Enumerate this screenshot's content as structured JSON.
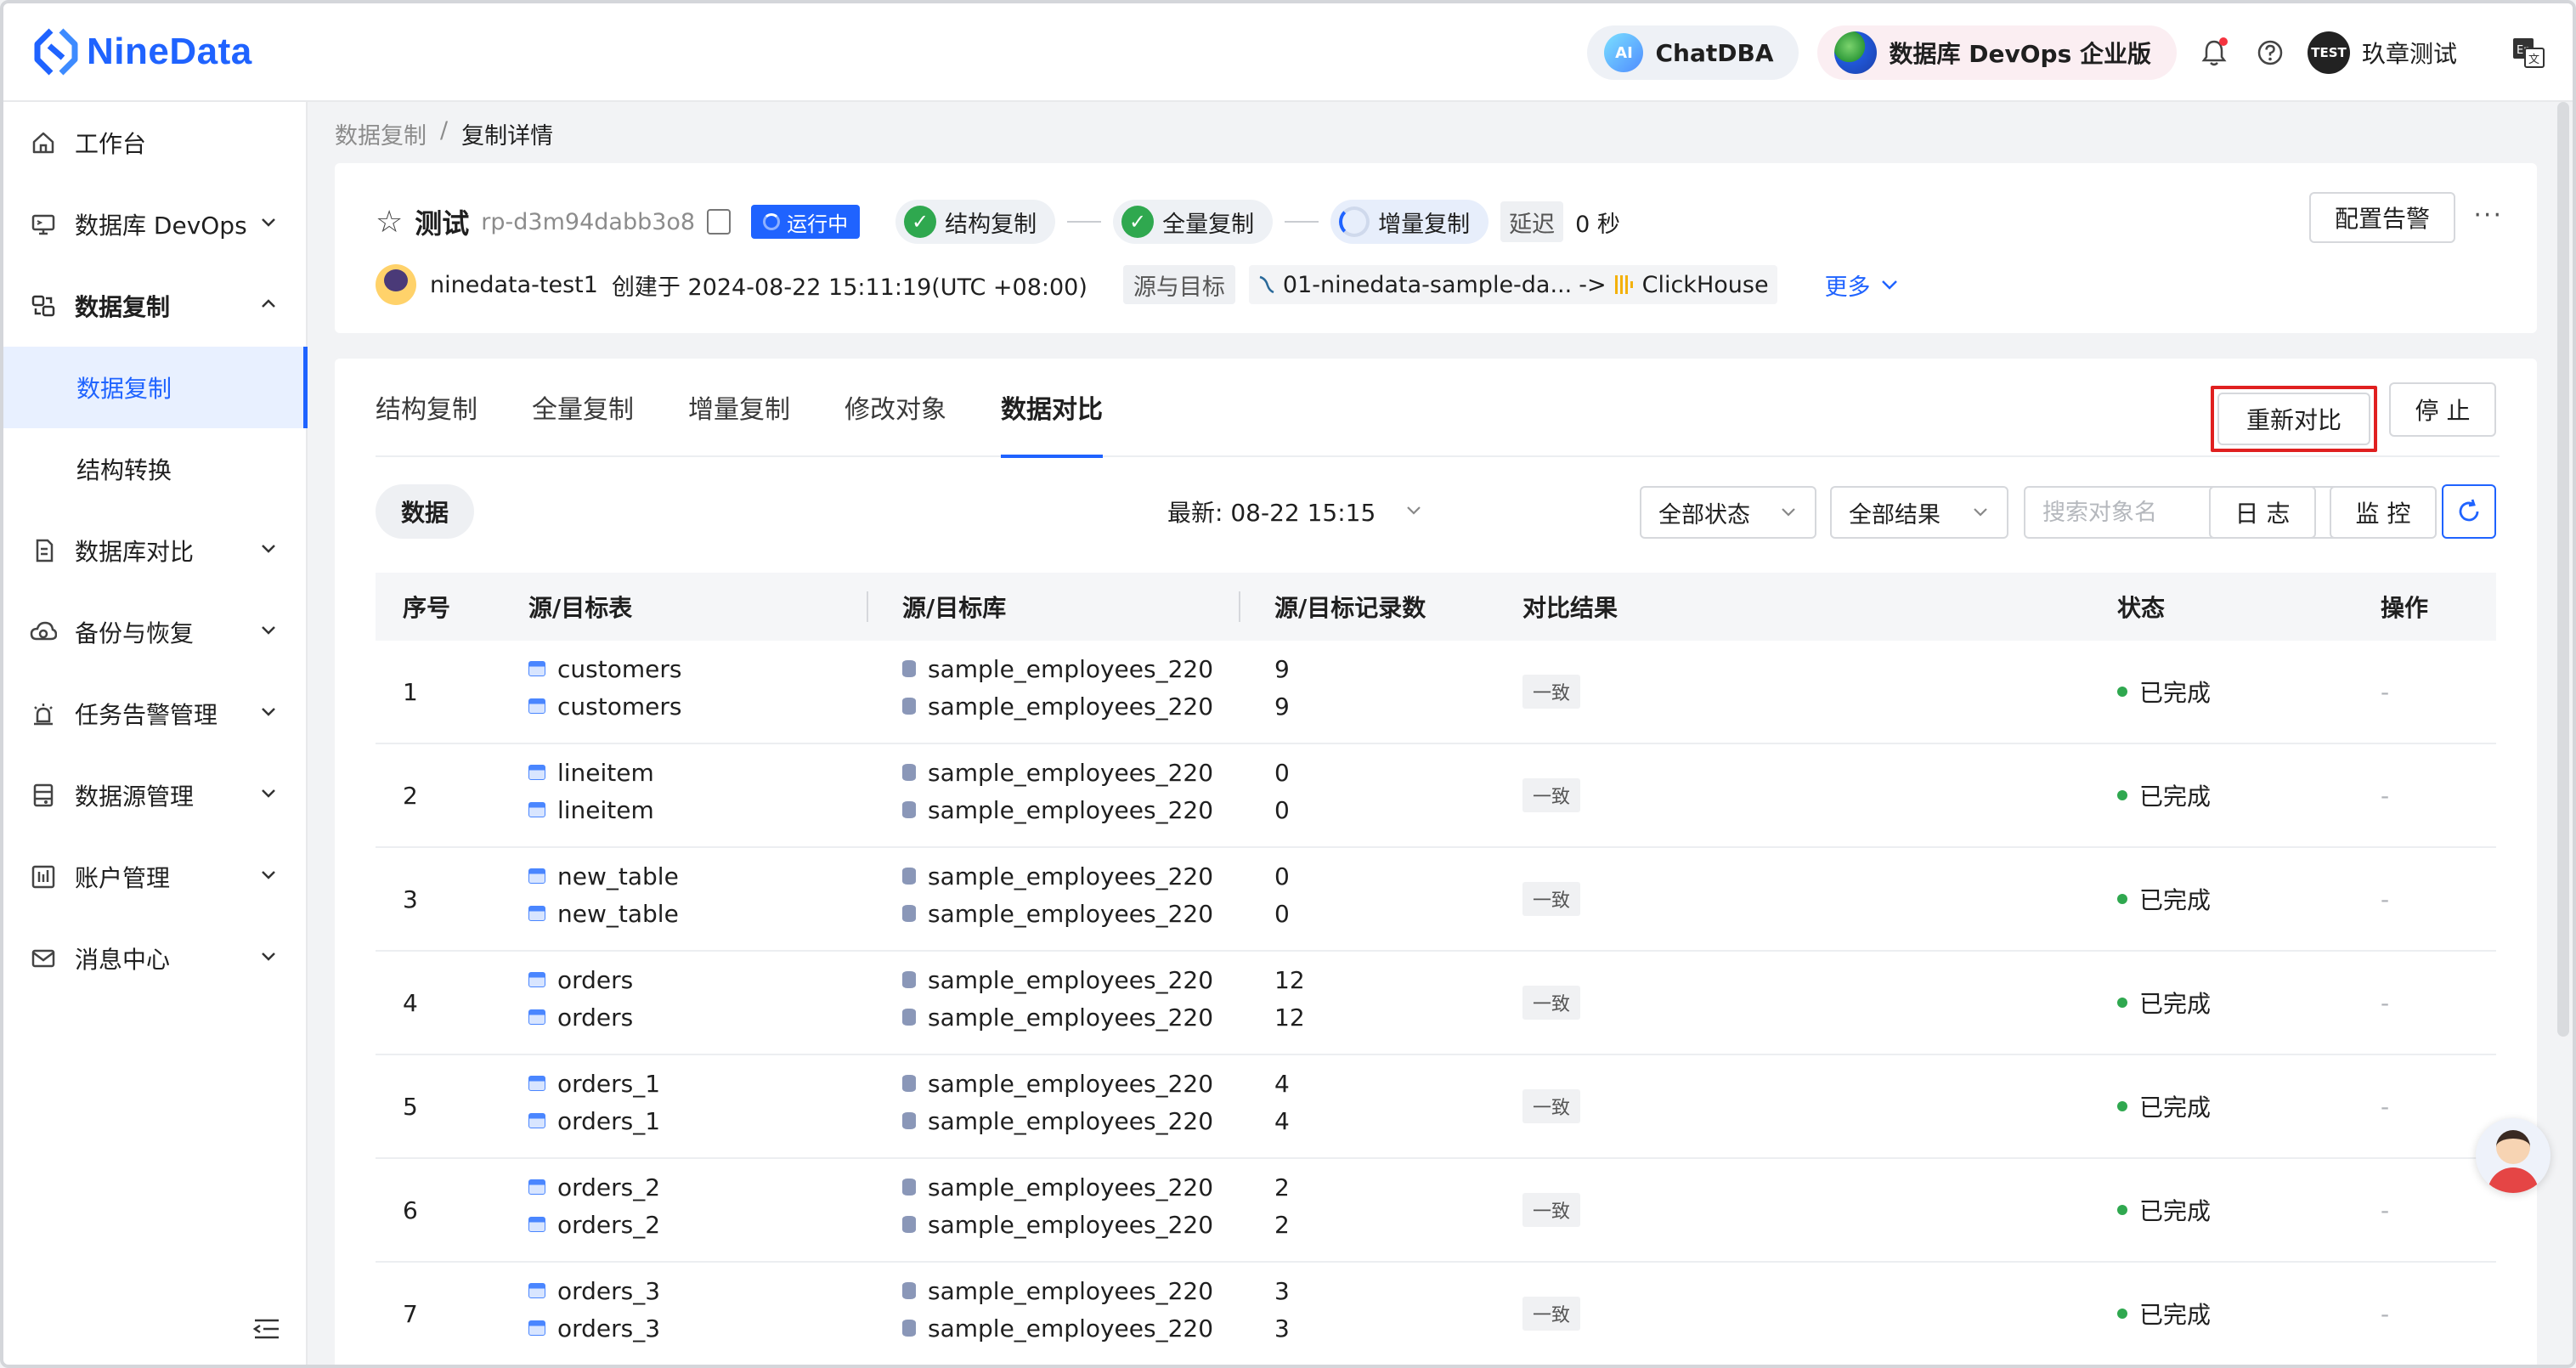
{
  "header": {
    "logo": "NineData",
    "chatdba": "ChatDBA",
    "ai_badge": "AI",
    "devops": "数据库 DevOps 企业版",
    "user_badge": "TEST",
    "user_name": "玖章测试",
    "icons": [
      "bell-icon",
      "help-icon",
      "language-icon"
    ]
  },
  "sidebar": {
    "items": [
      {
        "label": "工作台",
        "icon": "home-icon"
      },
      {
        "label": "数据库 DevOps",
        "icon": "monitor-icon"
      },
      {
        "label": "数据复制",
        "icon": "replication-icon"
      },
      {
        "label": "数据库对比",
        "icon": "compare-icon"
      },
      {
        "label": "备份与恢复",
        "icon": "cloud-backup-icon"
      },
      {
        "label": "任务告警管理",
        "icon": "alarm-icon"
      },
      {
        "label": "数据源管理",
        "icon": "datasource-icon"
      },
      {
        "label": "账户管理",
        "icon": "account-icon"
      },
      {
        "label": "消息中心",
        "icon": "mail-icon"
      }
    ],
    "sub_items": [
      "数据复制",
      "结构转换"
    ]
  },
  "breadcrumb": {
    "parent": "数据复制",
    "sep": "/",
    "current": "复制详情"
  },
  "task": {
    "name": "测试",
    "id": "rp-d3m94dabb3o8",
    "state": "运行中",
    "stages": [
      "结构复制",
      "全量复制",
      "增量复制"
    ],
    "delay_label": "延迟",
    "delay_value": "0 秒",
    "creator": "ninedata-test1",
    "created_text": "创建于 2024-08-22 15:11:19(UTC +08:00)",
    "src_target_label": "源与目标",
    "source": "01-ninedata-sample-da...",
    "arrow": "->",
    "target": "ClickHouse",
    "more": "更多",
    "config_alert": "配置告警",
    "more_dots": "···"
  },
  "tabs": [
    "结构复制",
    "全量复制",
    "增量复制",
    "修改对象",
    "数据对比"
  ],
  "actions": {
    "recompare": "重新对比",
    "stop": "停 止"
  },
  "toolbar": {
    "data_chip": "数据",
    "latest": "最新:  08-22 15:15",
    "status_filter": "全部状态",
    "result_filter": "全部结果",
    "search_placeholder": "搜索对象名",
    "log": "日 志",
    "monitor": "监 控"
  },
  "table": {
    "headers": [
      "序号",
      "源/目标表",
      "源/目标库",
      "源/目标记录数",
      "对比结果",
      "状态",
      "操作"
    ],
    "rows": [
      {
        "no": "1",
        "src_table": "customers",
        "dst_table": "customers",
        "src_db": "sample_employees_220",
        "dst_db": "sample_employees_220",
        "src_count": "9",
        "dst_count": "9",
        "result": "一致",
        "status": "已完成",
        "op": "-"
      },
      {
        "no": "2",
        "src_table": "lineitem",
        "dst_table": "lineitem",
        "src_db": "sample_employees_220",
        "dst_db": "sample_employees_220",
        "src_count": "0",
        "dst_count": "0",
        "result": "一致",
        "status": "已完成",
        "op": "-"
      },
      {
        "no": "3",
        "src_table": "new_table",
        "dst_table": "new_table",
        "src_db": "sample_employees_220",
        "dst_db": "sample_employees_220",
        "src_count": "0",
        "dst_count": "0",
        "result": "一致",
        "status": "已完成",
        "op": "-"
      },
      {
        "no": "4",
        "src_table": "orders",
        "dst_table": "orders",
        "src_db": "sample_employees_220",
        "dst_db": "sample_employees_220",
        "src_count": "12",
        "dst_count": "12",
        "result": "一致",
        "status": "已完成",
        "op": "-"
      },
      {
        "no": "5",
        "src_table": "orders_1",
        "dst_table": "orders_1",
        "src_db": "sample_employees_220",
        "dst_db": "sample_employees_220",
        "src_count": "4",
        "dst_count": "4",
        "result": "一致",
        "status": "已完成",
        "op": "-"
      },
      {
        "no": "6",
        "src_table": "orders_2",
        "dst_table": "orders_2",
        "src_db": "sample_employees_220",
        "dst_db": "sample_employees_220",
        "src_count": "2",
        "dst_count": "2",
        "result": "一致",
        "status": "已完成",
        "op": "-"
      },
      {
        "no": "7",
        "src_table": "orders_3",
        "dst_table": "orders_3",
        "src_db": "sample_employees_220",
        "dst_db": "sample_employees_220",
        "src_count": "3",
        "dst_count": "3",
        "result": "一致",
        "status": "已完成",
        "op": "-"
      }
    ]
  }
}
